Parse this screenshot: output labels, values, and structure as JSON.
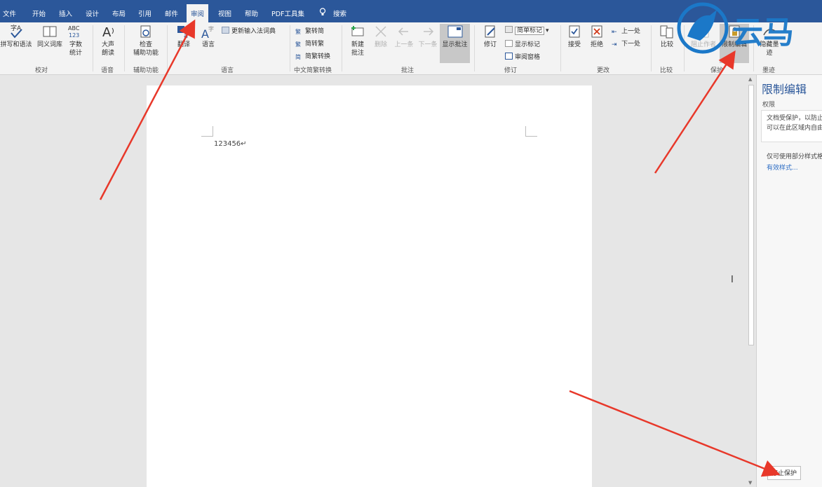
{
  "tabs": [
    "文件",
    "开始",
    "插入",
    "设计",
    "布局",
    "引用",
    "邮件",
    "审阅",
    "视图",
    "帮助",
    "PDF工具集",
    "搜索"
  ],
  "active_tab": "审阅",
  "ribbon": {
    "proofing": {
      "spelling": "拼写和语法",
      "thesaurus": "同义词库",
      "wordcount_1": "字数",
      "wordcount_2": "统计",
      "wordcount_icon": "ABC\n123",
      "group": "校对"
    },
    "speech": {
      "read_1": "大声",
      "read_2": "朗读",
      "group": "语音"
    },
    "accessibility": {
      "check_1": "检查",
      "check_2": "辅助功能",
      "group": "辅助功能"
    },
    "language": {
      "translate": "翻译",
      "language": "语言",
      "update_ime": "更新输入法词典",
      "group": "语言"
    },
    "chinese": {
      "to_trad": "繁转简",
      "to_simp": "简转繁",
      "convert": "简繁转换",
      "group": "中文简繁转换"
    },
    "comments": {
      "new_1": "新建",
      "new_2": "批注",
      "delete": "删除",
      "prev": "上一条",
      "next": "下一条",
      "show": "显示批注",
      "group": "批注"
    },
    "tracking": {
      "track": "修订",
      "markup_select": "简单标记",
      "show_markup": "显示标记",
      "review_pane": "审阅窗格",
      "group": "修订"
    },
    "changes": {
      "accept": "接受",
      "reject": "拒绝",
      "prev": "上一处",
      "next": "下一处",
      "group": "更改"
    },
    "compare": {
      "compare": "比较",
      "group": "比较"
    },
    "protect": {
      "block": "阻止作者",
      "restrict": "限制编辑",
      "group": "保护"
    },
    "ink": {
      "hide_1": "隐藏墨",
      "hide_2": "迹",
      "group": "墨迹"
    }
  },
  "document": {
    "text": "123456↵"
  },
  "pane": {
    "title": "限制编辑",
    "section": "权限",
    "line1": "文档受保护，以防止",
    "line2": "可以在此区域内自由",
    "line3": "仅可使用部分样式格",
    "link": "有效样式...",
    "stop_button": "停止保护"
  },
  "watermark": {
    "text": "云马"
  },
  "colors": {
    "accent": "#2b579a",
    "arrow": "#e8382a",
    "logo": "#1b78c8"
  }
}
